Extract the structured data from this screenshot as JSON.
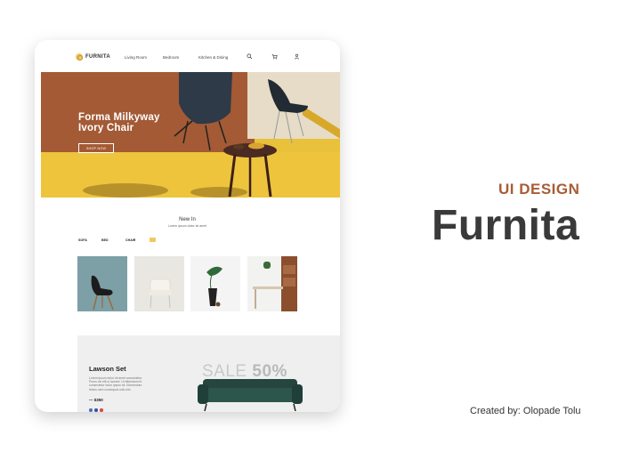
{
  "nav": {
    "logo": "FURNITA",
    "links": [
      "Living Room",
      "Bedroom",
      "Kitchen & Dining"
    ],
    "icons": [
      "search-icon",
      "cart-icon",
      "user-icon"
    ]
  },
  "hero": {
    "title_line1": "Forma Milkyway",
    "title_line2": "Ivory Chair",
    "button": "SHOP NOW"
  },
  "new_in": {
    "title": "New In",
    "subtitle": "Lorem ipsum dolor sit amet",
    "filters": [
      "SOFA",
      "BED",
      "CHAIR"
    ]
  },
  "sale": {
    "title": "Lawson Set",
    "description": "Lorem ipsum dolor sit amet consectetur. Purus vel elit ut laoreet. Ut bibendum id consectetur dolor ipsum sit. Elementum lectus nam consequat odio nisl.",
    "price": "— $350",
    "sale_word": "SALE",
    "sale_percent": "50%",
    "swatches": [
      "#4a6fb5",
      "#3d4ea3",
      "#d94a3c"
    ]
  },
  "side": {
    "label": "UI DESIGN",
    "brand": "Furnita",
    "credit": "Created by: Olopade Tolu"
  },
  "colors": {
    "accent": "#a75d35",
    "logo_yellow": "#f1c765",
    "hero_floor": "#edc43c"
  }
}
